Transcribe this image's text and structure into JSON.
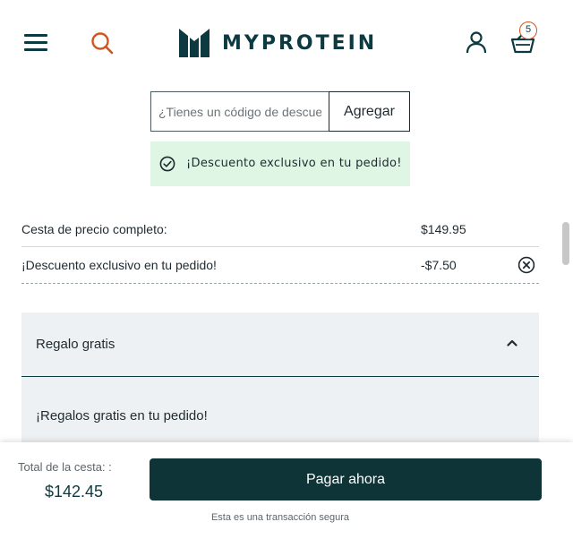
{
  "header": {
    "logo_text": "MYPROTEIN",
    "basket_count": "5",
    "brand_color": "#0c3a40",
    "accent_color": "#d2541e"
  },
  "promo": {
    "placeholder": "¿Tienes un código de descuento?",
    "value": "",
    "apply_label": "Agregar"
  },
  "discount_banner": {
    "text": "¡Descuento exclusivo en tu pedido!",
    "icon": "check-circle-icon",
    "bg_color": "#dff6e5"
  },
  "summary": {
    "full_price_label": "Cesta de precio completo:",
    "full_price_value": "$149.95",
    "discount_label": "¡Descuento exclusivo en tu pedido!",
    "discount_value": "-$7.50",
    "remove_icon": "close-circle-icon"
  },
  "gift": {
    "title": "Regalo gratis",
    "expanded": true,
    "body": "¡Regalos gratis en tu pedido!"
  },
  "footer": {
    "total_label": "Total de la cesta: :",
    "total_value": "$142.45",
    "pay_label": "Pagar ahora",
    "secure_text": "Esta es una transacción segura",
    "pay_color": "#0f3438"
  }
}
